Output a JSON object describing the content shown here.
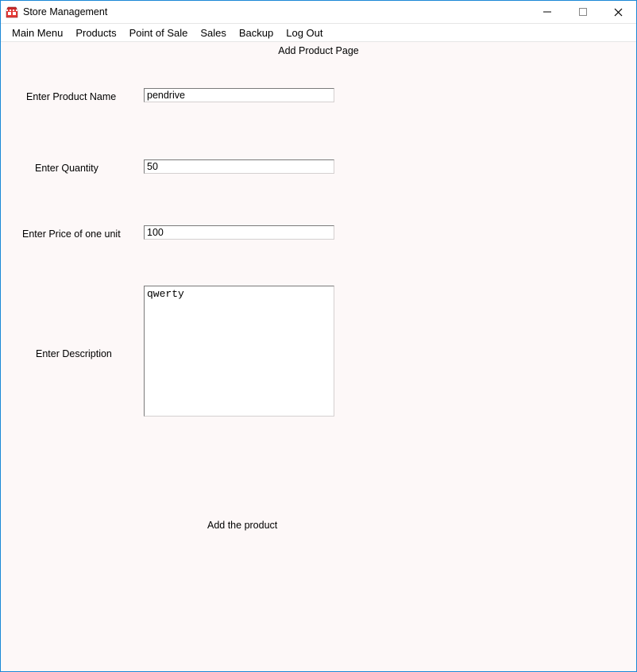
{
  "window": {
    "title": "Store Management"
  },
  "menubar": {
    "items": [
      "Main Menu",
      "Products",
      "Point of Sale",
      "Sales",
      "Backup",
      "Log Out"
    ]
  },
  "page": {
    "title": "Add Product Page"
  },
  "form": {
    "product_name": {
      "label": "Enter Product Name",
      "value": "pendrive"
    },
    "quantity": {
      "label": "Enter Quantity",
      "value": "50"
    },
    "price": {
      "label": "Enter Price of one unit",
      "value": "100"
    },
    "description": {
      "label": "Enter Description",
      "value": "qwerty"
    }
  },
  "actions": {
    "add_product_label": "Add the product"
  }
}
